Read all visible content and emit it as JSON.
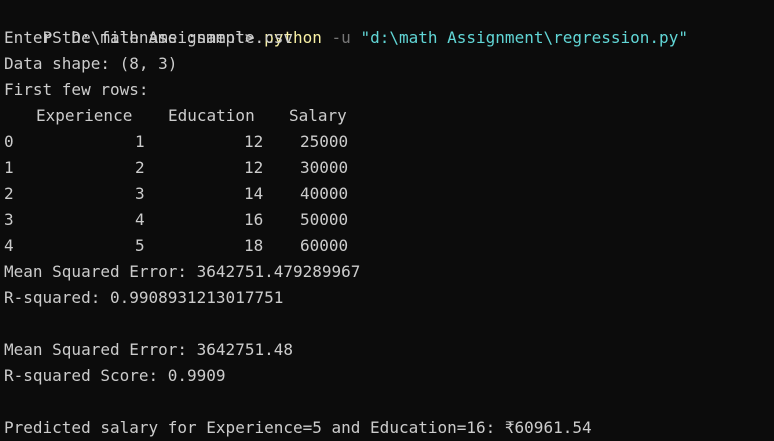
{
  "prompt": {
    "path": "PS D:\\math Assignment> ",
    "command": "python",
    "flag": "-u",
    "arg": "\"d:\\math Assignment\\regression.py\""
  },
  "output": {
    "filename_prompt": "Enter the filename :sample.csv",
    "data_shape": "Data shape: (8, 3)",
    "first_rows_label": "First few rows:",
    "table": {
      "columns": [
        "Experience",
        "Education",
        "Salary"
      ],
      "rows": [
        {
          "index": "0",
          "experience": "1",
          "education": "12",
          "salary": "25000"
        },
        {
          "index": "1",
          "experience": "2",
          "education": "12",
          "salary": "30000"
        },
        {
          "index": "2",
          "experience": "3",
          "education": "14",
          "salary": "40000"
        },
        {
          "index": "3",
          "experience": "4",
          "education": "16",
          "salary": "50000"
        },
        {
          "index": "4",
          "experience": "5",
          "education": "18",
          "salary": "60000"
        }
      ]
    },
    "mse_raw": "Mean Squared Error: 3642751.479289967",
    "r2_raw": "R-squared: 0.9908931213017751",
    "mse_rounded": "Mean Squared Error: 3642751.48",
    "r2_rounded": "R-squared Score: 0.9909",
    "prediction": "Predicted salary for Experience=5 and Education=16: ₹60961.54"
  },
  "colors": {
    "background": "#0c0c0c",
    "text": "#cccccc",
    "command": "#f9f1a5",
    "flag": "#767676",
    "argument": "#61d6d6"
  }
}
